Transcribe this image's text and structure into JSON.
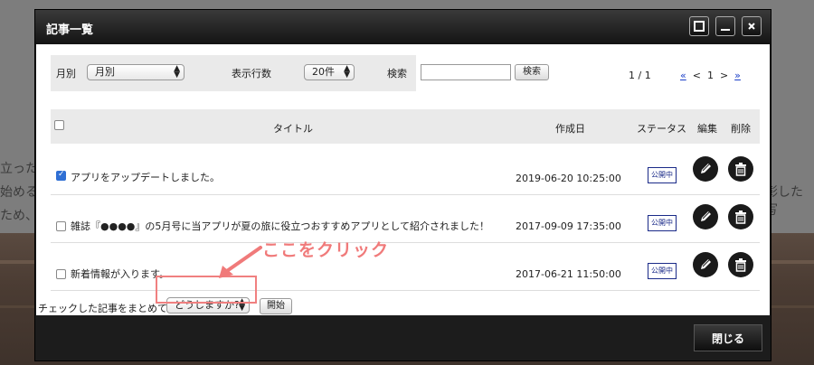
{
  "background": {
    "text_lines": [
      "立った",
      "始める",
      "ため、",
      "彰した写"
    ]
  },
  "modal": {
    "title": "記事一覧",
    "close_label": "閉じる"
  },
  "filters": {
    "month_label": "月別",
    "month_select_value": "月別",
    "rows_label": "表示行数",
    "rows_select_value": "20件",
    "search_label": "検索",
    "search_value": "",
    "search_button_label": "検索"
  },
  "pagination": {
    "page_info": "1 / 1",
    "first": "«",
    "prev": "<",
    "current": "1",
    "next": ">",
    "last": "»"
  },
  "table": {
    "headers": {
      "title": "タイトル",
      "created": "作成日",
      "status": "ステータス",
      "edit": "編集",
      "delete": "削除"
    },
    "rows": [
      {
        "checked": true,
        "title": "アプリをアップデートしました。",
        "created": "2019-06-20 10:25:00",
        "status": "公開中"
      },
      {
        "checked": false,
        "title": "雑誌『●●●●』の5月号に当アプリが夏の旅に役立つおすすめアプリとして紹介されました！",
        "created": "2017-09-09 17:35:00",
        "status": "公開中"
      },
      {
        "checked": false,
        "title": "新着情報が入ります。",
        "created": "2017-06-21 11:50:00",
        "status": "公開中"
      }
    ]
  },
  "bulk": {
    "label": "チェックした記事をまとめて",
    "action_select_value": "どうしますか?",
    "start_button_label": "開始"
  },
  "annotation": {
    "text": "ここをクリック",
    "color": "#f07a7a"
  },
  "colors": {
    "link": "#1a3ec7",
    "status_border": "#1a2a88",
    "checkbox_checked": "#2f6fd4"
  }
}
